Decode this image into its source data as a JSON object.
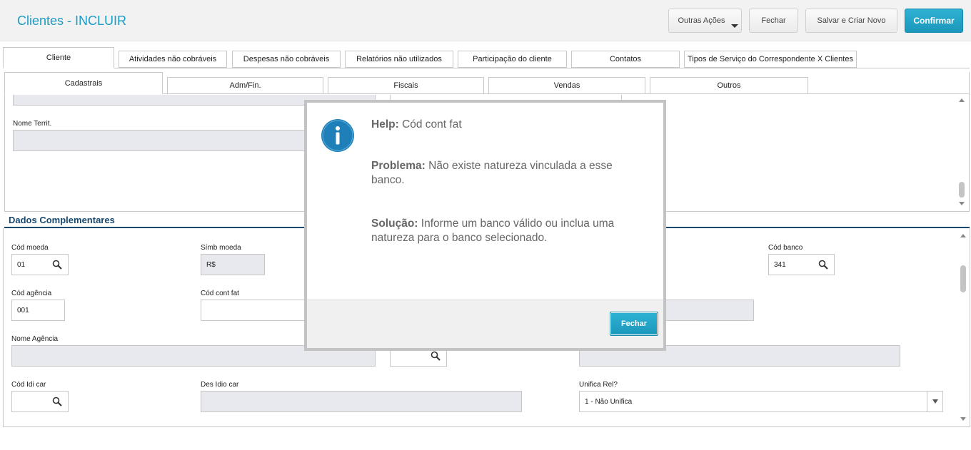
{
  "header": {
    "title": "Clientes - INCLUIR",
    "buttons": {
      "other_actions": "Outras Ações",
      "close": "Fechar",
      "save_new": "Salvar e Criar Novo",
      "confirm": "Confirmar"
    }
  },
  "main_tabs": [
    {
      "label": "Cliente",
      "active": true
    },
    {
      "label": "Atividades não cobráveis"
    },
    {
      "label": "Despesas não cobráveis"
    },
    {
      "label": "Relatórios não utilizados"
    },
    {
      "label": "Participação do cliente"
    },
    {
      "label": "Contatos"
    },
    {
      "label": "Tipos de Serviço do Correspondente X Clientes"
    }
  ],
  "sub_tabs": [
    {
      "label": "Cadastrais",
      "active": true
    },
    {
      "label": "Adm/Fin."
    },
    {
      "label": "Fiscais"
    },
    {
      "label": "Vendas"
    },
    {
      "label": "Outros"
    }
  ],
  "top_panel": {
    "nome_territ_label": "Nome Territ.",
    "nome_territ_value": ""
  },
  "dados_complementares": {
    "title": "Dados Complementares",
    "fields": {
      "cod_moeda": {
        "label": "Cód moeda",
        "value": "01"
      },
      "simb_moeda": {
        "label": "Símb moeda",
        "value": "R$"
      },
      "cod_banco": {
        "label": "Cód banco",
        "value": "341"
      },
      "cod_agencia": {
        "label": "Cód agência",
        "value": "001"
      },
      "cod_cont_fat": {
        "label": "Cód cont fat",
        "value": ""
      },
      "nome_agencia": {
        "label": "Nome Agência",
        "value": ""
      },
      "cod_idi_car": {
        "label": "Cód Idi car",
        "value": ""
      },
      "des_idio_car": {
        "label": "Des Idio car",
        "value": ""
      },
      "unifica_rel": {
        "label": "Unifica Rel?",
        "value": "1 - Não Unifica"
      }
    }
  },
  "modal": {
    "help_label": "Help:",
    "help_text": "Cód cont fat",
    "problem_label": "Problema:",
    "problem_text": "Não existe natureza vinculada a esse banco.",
    "solution_label": "Solução:",
    "solution_text": "Informe um banco válido ou inclua uma natureza para o banco selecionado.",
    "close_button": "Fechar"
  },
  "colors": {
    "title": "#1d9bc4",
    "primary_button": "#1b97bb",
    "section_title": "#17486e",
    "info_icon": "#1f7fb8"
  },
  "icons": [
    "search-icon",
    "info-icon",
    "chevron-down-icon",
    "scroll-up-arrow",
    "scroll-down-arrow"
  ]
}
